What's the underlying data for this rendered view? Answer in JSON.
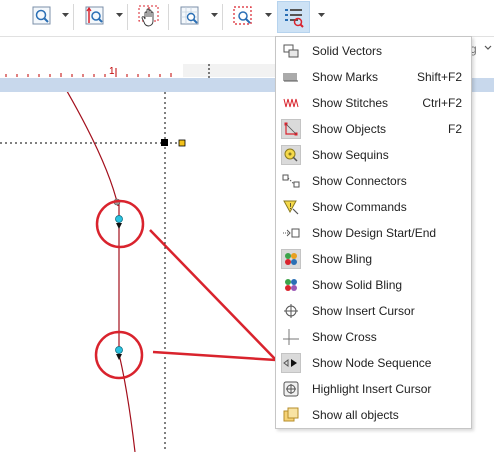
{
  "toolbar": {
    "buttons": [
      {
        "icon": "zoom-icon"
      },
      {
        "icon": "zoom-area-icon"
      },
      {
        "icon": "pan-icon"
      },
      {
        "icon": "zoom-grid-icon"
      },
      {
        "icon": "zoom-selection-icon"
      },
      {
        "icon": "show-list-icon",
        "active": true
      }
    ]
  },
  "header_right": {
    "text": "g"
  },
  "ruler": {
    "label": "1"
  },
  "menu": {
    "items": [
      {
        "label": "Solid Vectors",
        "shortcut": "",
        "icon": "solid-vectors-icon",
        "checked": false
      },
      {
        "label": "Show Marks",
        "shortcut": "Shift+F2",
        "icon": "marks-icon",
        "checked": false
      },
      {
        "label": "Show Stitches",
        "shortcut": "Ctrl+F2",
        "icon": "stitches-icon",
        "checked": false
      },
      {
        "label": "Show Objects",
        "shortcut": "F2",
        "icon": "objects-icon",
        "checked": true
      },
      {
        "label": "Show Sequins",
        "shortcut": "",
        "icon": "sequins-icon",
        "checked": true
      },
      {
        "label": "Show Connectors",
        "shortcut": "",
        "icon": "connectors-icon",
        "checked": false
      },
      {
        "label": "Show Commands",
        "shortcut": "",
        "icon": "commands-icon",
        "checked": false
      },
      {
        "label": "Show Design Start/End",
        "shortcut": "",
        "icon": "design-start-end-icon",
        "checked": false
      },
      {
        "label": "Show Bling",
        "shortcut": "",
        "icon": "bling-icon",
        "checked": true
      },
      {
        "label": "Show Solid Bling",
        "shortcut": "",
        "icon": "solid-bling-icon",
        "checked": false
      },
      {
        "label": "Show Insert Cursor",
        "shortcut": "",
        "icon": "insert-cursor-icon",
        "checked": false
      },
      {
        "label": "Show Cross",
        "shortcut": "",
        "icon": "cross-icon",
        "checked": false
      },
      {
        "label": "Show Node Sequence",
        "shortcut": "",
        "icon": "node-sequence-icon",
        "checked": true
      },
      {
        "label": "Highlight Insert Cursor",
        "shortcut": "",
        "icon": "highlight-cursor-icon",
        "checked": false
      },
      {
        "label": "Show all objects",
        "shortcut": "",
        "icon": "all-objects-icon",
        "checked": false
      }
    ]
  },
  "colors": {
    "accent": "#cde2f5",
    "annotation": "#d9232d",
    "stitch_line": "#a30f1c",
    "node": "#29c2e0"
  }
}
